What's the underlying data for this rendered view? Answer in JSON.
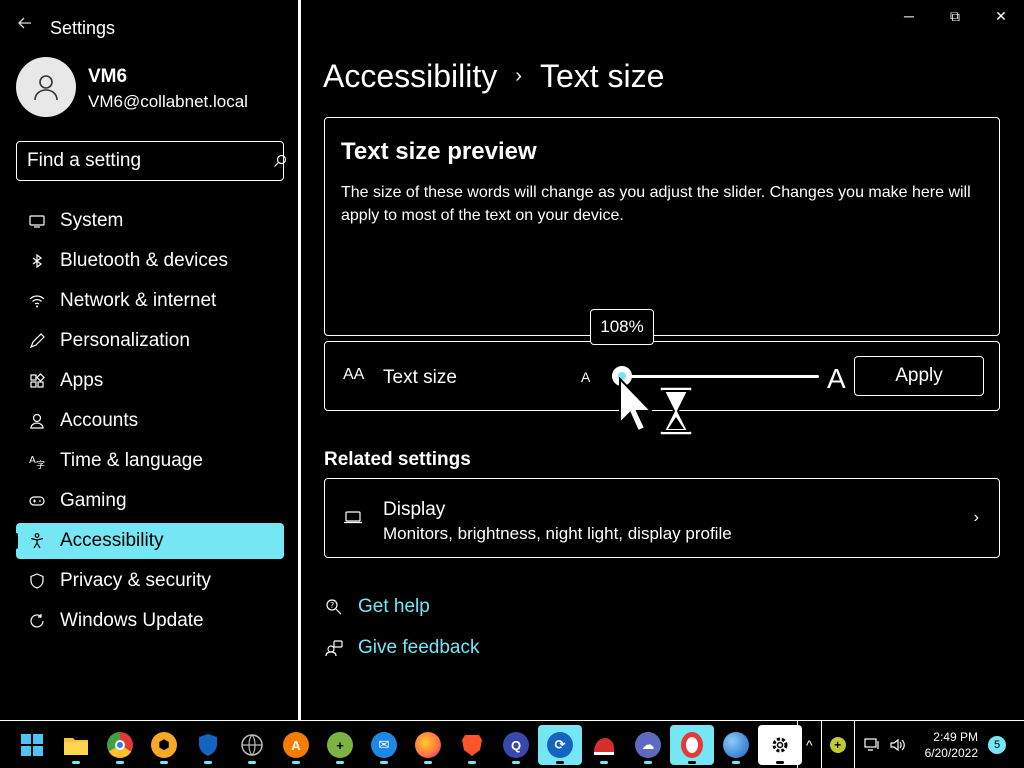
{
  "app": {
    "title": "Settings",
    "back_icon": "back-arrow-icon"
  },
  "user": {
    "name": "VM6",
    "email": "VM6@collabnet.local"
  },
  "search": {
    "placeholder": "Find a setting"
  },
  "nav": {
    "items": [
      {
        "label": "System",
        "icon": "monitor-icon"
      },
      {
        "label": "Bluetooth & devices",
        "icon": "bluetooth-icon"
      },
      {
        "label": "Network & internet",
        "icon": "wifi-icon"
      },
      {
        "label": "Personalization",
        "icon": "pen-icon"
      },
      {
        "label": "Apps",
        "icon": "apps-icon"
      },
      {
        "label": "Accounts",
        "icon": "person-icon"
      },
      {
        "label": "Time & language",
        "icon": "globe-clock-icon"
      },
      {
        "label": "Gaming",
        "icon": "gamepad-icon"
      },
      {
        "label": "Accessibility",
        "icon": "accessibility-icon",
        "active": true
      },
      {
        "label": "Privacy & security",
        "icon": "shield-icon"
      },
      {
        "label": "Windows Update",
        "icon": "update-icon"
      }
    ]
  },
  "window": {
    "minimize": "─",
    "restore": "⧉",
    "close": "✕"
  },
  "breadcrumb": {
    "parent": "Accessibility",
    "separator": "›",
    "current": "Text size"
  },
  "preview": {
    "title": "Text size preview",
    "text": "The size of these words will change as you adjust the slider. Changes you make here will apply to most of the text on your device."
  },
  "text_size": {
    "icon_text": "AA",
    "label": "Text size",
    "small_a": "A",
    "big_a": "A",
    "value_percent": 108,
    "tooltip": "108%",
    "apply_label": "Apply"
  },
  "related": {
    "title": "Related settings",
    "display_title": "Display",
    "display_subtitle": "Monitors, brightness, night light, display profile",
    "chevron": "›"
  },
  "links": {
    "get_help": "Get help",
    "give_feedback": "Give feedback"
  },
  "taskbar": {
    "apps": [
      {
        "name": "start-icon"
      },
      {
        "name": "file-explorer-icon"
      },
      {
        "name": "chrome-icon"
      },
      {
        "name": "browser-shield-icon"
      },
      {
        "name": "defender-shield-icon"
      },
      {
        "name": "network-globe-icon"
      },
      {
        "name": "avast-icon"
      },
      {
        "name": "plus-app-icon"
      },
      {
        "name": "thunderbird-icon"
      },
      {
        "name": "firefox-icon"
      },
      {
        "name": "brave-icon"
      },
      {
        "name": "search-q-icon"
      },
      {
        "name": "sync-app-icon",
        "active": true
      },
      {
        "name": "remote-app-icon"
      },
      {
        "name": "cloud-drive-icon"
      },
      {
        "name": "opera-icon",
        "active": true
      },
      {
        "name": "globe-browser-icon"
      },
      {
        "name": "settings-gear-icon",
        "active": true
      }
    ],
    "time": "2:49 PM",
    "date": "6/20/2022",
    "notifications": "5",
    "chevron": "^"
  }
}
